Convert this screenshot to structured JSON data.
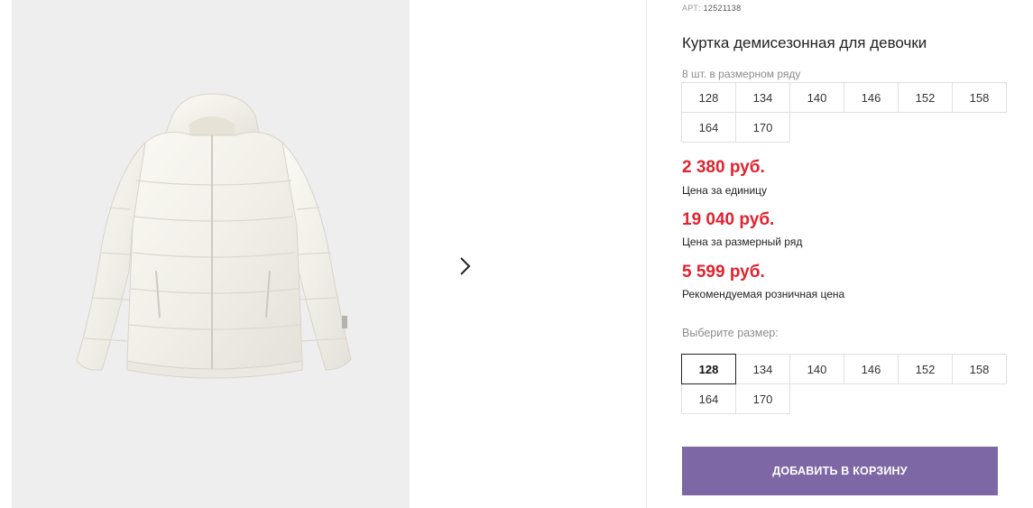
{
  "product": {
    "sku_label": "АРТ:",
    "sku": "12521138",
    "title": "Куртка демисезонная для девочки",
    "pack_note": "8 шт. в размерном ряду",
    "pack_sizes": [
      "128",
      "134",
      "140",
      "146",
      "152",
      "158",
      "164",
      "170"
    ]
  },
  "prices": [
    {
      "value": "2 380 руб.",
      "label": "Цена за единицу"
    },
    {
      "value": "19 040 руб.",
      "label": "Цена за размерный ряд"
    },
    {
      "value": "5 599 руб.",
      "label": "Рекомендуемая розничная цена"
    }
  ],
  "size_picker": {
    "label": "Выберите размер:",
    "options": [
      "128",
      "134",
      "140",
      "146",
      "152",
      "158",
      "164",
      "170"
    ],
    "selected": "128"
  },
  "add_to_cart_label": "ДОБАВИТЬ В КОРЗИНУ",
  "gallery": {
    "next_icon": "chevron-right-icon",
    "image": "white-puffer-jacket-with-hood"
  },
  "colors": {
    "price": "#e1222f",
    "button": "#7d67a5",
    "gallery_bg": "#eeeeee"
  }
}
